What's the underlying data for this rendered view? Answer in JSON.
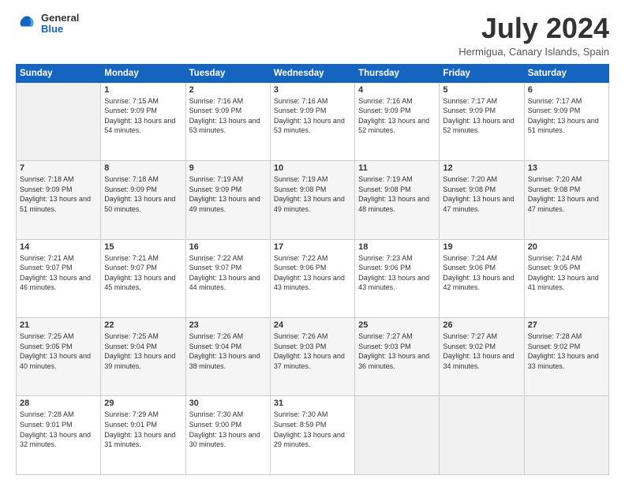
{
  "header": {
    "logo": {
      "general": "General",
      "blue": "Blue"
    },
    "title": "July 2024",
    "location": "Hermigua, Canary Islands, Spain"
  },
  "weekdays": [
    "Sunday",
    "Monday",
    "Tuesday",
    "Wednesday",
    "Thursday",
    "Friday",
    "Saturday"
  ],
  "weeks": [
    [
      {
        "day": "",
        "empty": true
      },
      {
        "day": "1",
        "sunrise": "7:15 AM",
        "sunset": "9:09 PM",
        "daylight": "13 hours and 54 minutes."
      },
      {
        "day": "2",
        "sunrise": "7:16 AM",
        "sunset": "9:09 PM",
        "daylight": "13 hours and 53 minutes."
      },
      {
        "day": "3",
        "sunrise": "7:16 AM",
        "sunset": "9:09 PM",
        "daylight": "13 hours and 53 minutes."
      },
      {
        "day": "4",
        "sunrise": "7:16 AM",
        "sunset": "9:09 PM",
        "daylight": "13 hours and 52 minutes."
      },
      {
        "day": "5",
        "sunrise": "7:17 AM",
        "sunset": "9:09 PM",
        "daylight": "13 hours and 52 minutes."
      },
      {
        "day": "6",
        "sunrise": "7:17 AM",
        "sunset": "9:09 PM",
        "daylight": "13 hours and 51 minutes."
      }
    ],
    [
      {
        "day": "7",
        "sunrise": "7:18 AM",
        "sunset": "9:09 PM",
        "daylight": "13 hours and 51 minutes."
      },
      {
        "day": "8",
        "sunrise": "7:18 AM",
        "sunset": "9:09 PM",
        "daylight": "13 hours and 50 minutes."
      },
      {
        "day": "9",
        "sunrise": "7:19 AM",
        "sunset": "9:09 PM",
        "daylight": "13 hours and 49 minutes."
      },
      {
        "day": "10",
        "sunrise": "7:19 AM",
        "sunset": "9:08 PM",
        "daylight": "13 hours and 49 minutes."
      },
      {
        "day": "11",
        "sunrise": "7:19 AM",
        "sunset": "9:08 PM",
        "daylight": "13 hours and 48 minutes."
      },
      {
        "day": "12",
        "sunrise": "7:20 AM",
        "sunset": "9:08 PM",
        "daylight": "13 hours and 47 minutes."
      },
      {
        "day": "13",
        "sunrise": "7:20 AM",
        "sunset": "9:08 PM",
        "daylight": "13 hours and 47 minutes."
      }
    ],
    [
      {
        "day": "14",
        "sunrise": "7:21 AM",
        "sunset": "9:07 PM",
        "daylight": "13 hours and 46 minutes."
      },
      {
        "day": "15",
        "sunrise": "7:21 AM",
        "sunset": "9:07 PM",
        "daylight": "13 hours and 45 minutes."
      },
      {
        "day": "16",
        "sunrise": "7:22 AM",
        "sunset": "9:07 PM",
        "daylight": "13 hours and 44 minutes."
      },
      {
        "day": "17",
        "sunrise": "7:22 AM",
        "sunset": "9:06 PM",
        "daylight": "13 hours and 43 minutes."
      },
      {
        "day": "18",
        "sunrise": "7:23 AM",
        "sunset": "9:06 PM",
        "daylight": "13 hours and 43 minutes."
      },
      {
        "day": "19",
        "sunrise": "7:24 AM",
        "sunset": "9:06 PM",
        "daylight": "13 hours and 42 minutes."
      },
      {
        "day": "20",
        "sunrise": "7:24 AM",
        "sunset": "9:05 PM",
        "daylight": "13 hours and 41 minutes."
      }
    ],
    [
      {
        "day": "21",
        "sunrise": "7:25 AM",
        "sunset": "9:05 PM",
        "daylight": "13 hours and 40 minutes."
      },
      {
        "day": "22",
        "sunrise": "7:25 AM",
        "sunset": "9:04 PM",
        "daylight": "13 hours and 39 minutes."
      },
      {
        "day": "23",
        "sunrise": "7:26 AM",
        "sunset": "9:04 PM",
        "daylight": "13 hours and 38 minutes."
      },
      {
        "day": "24",
        "sunrise": "7:26 AM",
        "sunset": "9:03 PM",
        "daylight": "13 hours and 37 minutes."
      },
      {
        "day": "25",
        "sunrise": "7:27 AM",
        "sunset": "9:03 PM",
        "daylight": "13 hours and 36 minutes."
      },
      {
        "day": "26",
        "sunrise": "7:27 AM",
        "sunset": "9:02 PM",
        "daylight": "13 hours and 34 minutes."
      },
      {
        "day": "27",
        "sunrise": "7:28 AM",
        "sunset": "9:02 PM",
        "daylight": "13 hours and 33 minutes."
      }
    ],
    [
      {
        "day": "28",
        "sunrise": "7:28 AM",
        "sunset": "9:01 PM",
        "daylight": "13 hours and 32 minutes."
      },
      {
        "day": "29",
        "sunrise": "7:29 AM",
        "sunset": "9:01 PM",
        "daylight": "13 hours and 31 minutes."
      },
      {
        "day": "30",
        "sunrise": "7:30 AM",
        "sunset": "9:00 PM",
        "daylight": "13 hours and 30 minutes."
      },
      {
        "day": "31",
        "sunrise": "7:30 AM",
        "sunset": "8:59 PM",
        "daylight": "13 hours and 29 minutes."
      },
      {
        "day": "",
        "empty": true
      },
      {
        "day": "",
        "empty": true
      },
      {
        "day": "",
        "empty": true
      }
    ]
  ],
  "labels": {
    "sunrise": "Sunrise:",
    "sunset": "Sunset:",
    "daylight": "Daylight:"
  }
}
